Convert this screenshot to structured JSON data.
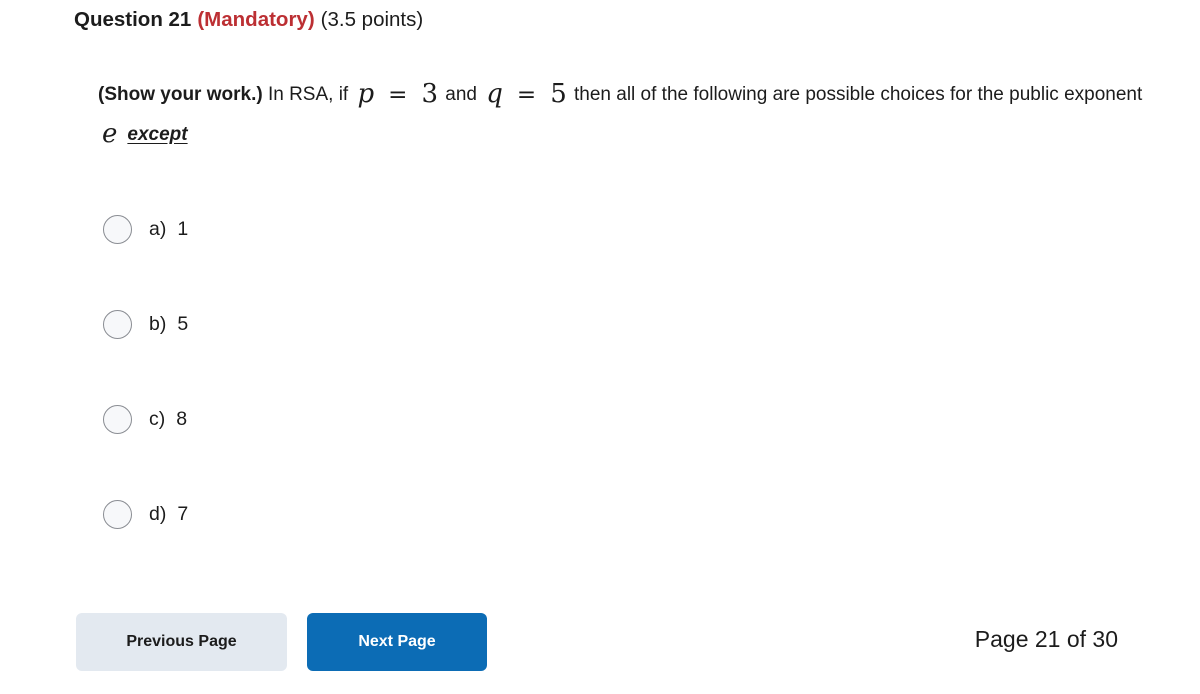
{
  "header": {
    "title": "Question 21",
    "mandatory": "(Mandatory)",
    "points": "(3.5 points)",
    "mandatory_color": "#bc2f33"
  },
  "question": {
    "prompt_bold": "(Show your work.)",
    "text_1": " In RSA, if ",
    "var_p": "p",
    "eq_1": "=",
    "num_p": "3",
    "text_2": " and ",
    "var_q": "q",
    "eq_2": "=",
    "num_q": "5",
    "text_3": " then all of the following are possible choices for the public exponent ",
    "var_e": "e",
    "except": "except"
  },
  "options": [
    {
      "letter": "a)",
      "value": "1",
      "selected": false
    },
    {
      "letter": "b)",
      "value": "5",
      "selected": false
    },
    {
      "letter": "c)",
      "value": "8",
      "selected": false
    },
    {
      "letter": "d)",
      "value": "7",
      "selected": false
    }
  ],
  "footer": {
    "previous_label": "Previous Page",
    "next_label": "Next Page",
    "page_indicator": "Page 21 of 30",
    "next_button_color": "#0c6cb5",
    "previous_button_color": "#e3e9f0"
  }
}
